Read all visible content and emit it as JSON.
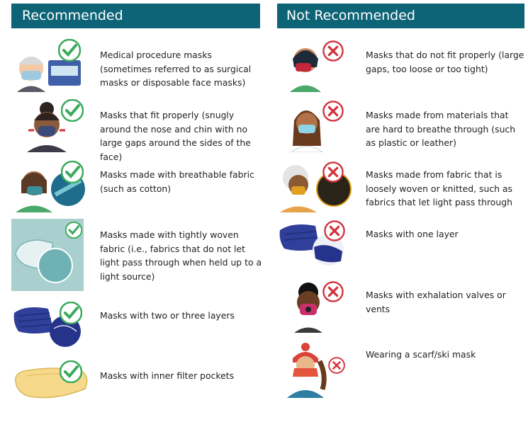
{
  "recommended": {
    "title": "Recommended",
    "items": [
      {
        "text": "Medical procedure masks (sometimes referred to as surgical masks or disposable face masks)",
        "illustration": "man-with-surgical-mask-and-mask-box",
        "status": "check-icon"
      },
      {
        "text": "Masks that fit properly (snugly around the nose and chin with no large gaps around the sides of the face)",
        "illustration": "woman-adjusting-fitted-mask",
        "status": "check-icon"
      },
      {
        "text": "Masks made with breathable fabric (such as cotton)",
        "illustration": "woman-with-breathable-fabric-mask",
        "status": "check-icon"
      },
      {
        "text": "Masks made with tightly woven fabric (i.e., fabrics that do not let light pass through when held up to a light source)",
        "illustration": "tightly-woven-fabric-mask",
        "status": "check-icon"
      },
      {
        "text": "Masks with two or three layers",
        "illustration": "layered-blue-mask",
        "status": "check-icon"
      },
      {
        "text": "Masks with inner filter pockets",
        "illustration": "mask-with-filter-pocket",
        "status": "check-icon"
      }
    ]
  },
  "not_recommended": {
    "title": "Not Recommended",
    "items": [
      {
        "text": "Masks that do not fit properly (large gaps, too loose or too tight)",
        "illustration": "woman-with-loose-mask",
        "status": "x-icon"
      },
      {
        "text": "Masks made from materials that are hard to breathe through (such as plastic or leather)",
        "illustration": "woman-with-plastic-mask",
        "status": "x-icon"
      },
      {
        "text": "Masks made from fabric that is loosely woven or knitted, such as fabrics that let light pass through",
        "illustration": "woman-with-loose-knit-mask",
        "status": "x-icon"
      },
      {
        "text": "Masks with one layer",
        "illustration": "single-layer-blue-mask",
        "status": "x-icon"
      },
      {
        "text": "Masks with exhalation valves or vents",
        "illustration": "man-with-valve-mask",
        "status": "x-icon"
      },
      {
        "text": "Wearing a scarf/ski mask",
        "illustration": "woman-with-scarf-and-ski-hat",
        "status": "x-icon"
      }
    ]
  },
  "colors": {
    "header_bg": "#0d6476",
    "check": "#3aaa5c",
    "cross": "#d2323c"
  }
}
